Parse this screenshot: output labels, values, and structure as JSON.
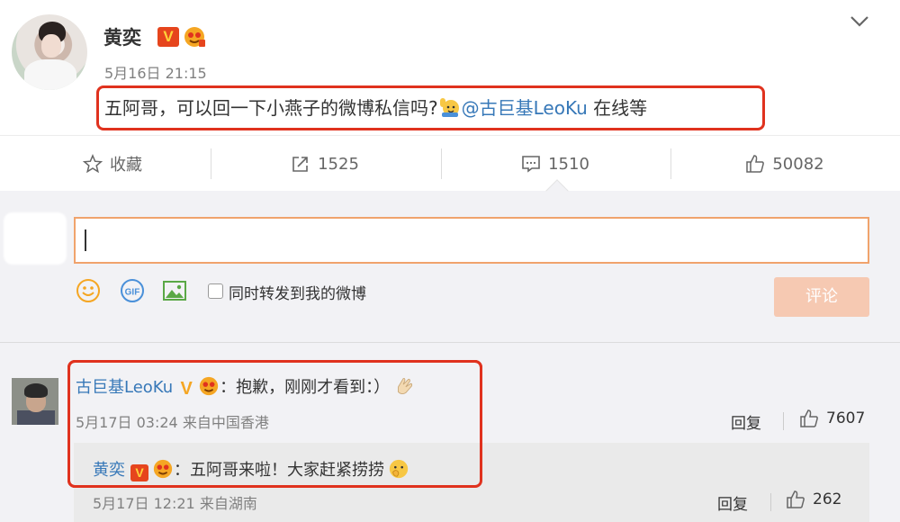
{
  "post": {
    "author": "黄奕",
    "verified_badge": "V",
    "timestamp": "5月16日 21:15",
    "text_before": "五阿哥，可以回一下小燕子的微博私信吗?",
    "mention": "@古巨基LeoKu",
    "text_after": " 在线等"
  },
  "actions": {
    "favorite_label": "收藏",
    "repost_count": "1525",
    "comment_count": "1510",
    "like_count": "50082"
  },
  "composer": {
    "sync_label": "同时转发到我的微博",
    "submit_label": "评论",
    "gif_label": "GIF"
  },
  "comment": {
    "author": "古巨基LeoKu",
    "badge": "V",
    "text": "：抱歉，刚刚才看到：）",
    "meta": "5月17日 03:24 来自中国香港",
    "reply_label": "回复",
    "like_count": "7607"
  },
  "sub_reply": {
    "author": "黄奕",
    "badge": "V",
    "text": "：五阿哥来啦！大家赶紧捞捞",
    "meta": "5月17日 12:21 来自湖南",
    "reply_label": "回复",
    "like_count": "262"
  },
  "colors": {
    "accent_link": "#3778b8",
    "highlight_box": "#e0321e",
    "submit_disabled": "#f6c9b2",
    "verified_badge": "#e6451d"
  },
  "icons": [
    "chevron-down-icon",
    "star-icon",
    "repost-icon",
    "comment-icon",
    "thumb-up-icon",
    "smile-icon",
    "gif-icon",
    "image-icon",
    "clap-emoji",
    "wave-emoji",
    "peek-emoji"
  ]
}
